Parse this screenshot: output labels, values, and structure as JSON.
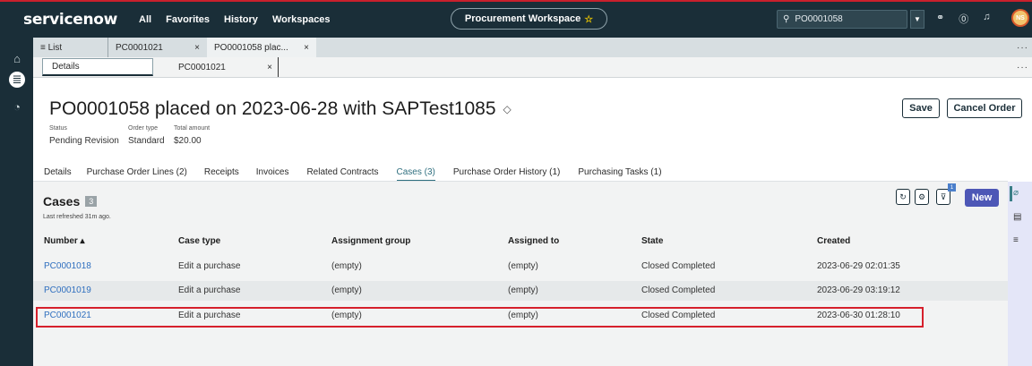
{
  "topbar": {
    "logo": "servicenow",
    "nav": [
      "All",
      "Favorites",
      "History",
      "Workspaces"
    ],
    "workspace": "Procurement Workspace",
    "search_value": "PO0001058",
    "avatar_initials": "NS"
  },
  "tabs_row1": {
    "list_label": "≡ List",
    "tabs": [
      {
        "label": "PC0001021",
        "close": "×"
      },
      {
        "label": "PO0001058 plac...",
        "close": "×"
      }
    ]
  },
  "tabs_row2": {
    "details_label": "Details",
    "tab_label": "PC0001021",
    "close": "×",
    "more": "..."
  },
  "record": {
    "title": "PO0001058 placed on 2023-06-28 with SAPTest1085",
    "save_label": "Save",
    "cancel_label": "Cancel Order",
    "fields": [
      {
        "label": "Status",
        "value": "Pending Revision"
      },
      {
        "label": "Order type",
        "value": "Standard"
      },
      {
        "label": "Total amount",
        "value": "$20.00"
      }
    ]
  },
  "subtabs": [
    "Details",
    "Purchase Order Lines (2)",
    "Receipts",
    "Invoices",
    "Related Contracts",
    "Cases (3)",
    "Purchase Order History (1)",
    "Purchasing Tasks (1)"
  ],
  "cases": {
    "title": "Cases",
    "count": "3",
    "refreshed": "Last refreshed 31m ago.",
    "filter_badge": "1",
    "new_label": "New",
    "columns": [
      "Number ▴",
      "Case type",
      "Assignment group",
      "Assigned to",
      "State",
      "Created"
    ],
    "rows": [
      [
        "PC0001018",
        "Edit a purchase",
        "(empty)",
        "(empty)",
        "Closed Completed",
        "2023-06-29 02:01:35"
      ],
      [
        "PC0001019",
        "Edit a purchase",
        "(empty)",
        "(empty)",
        "Closed Completed",
        "2023-06-29 03:19:12"
      ],
      [
        "PC0001021",
        "Edit a purchase",
        "(empty)",
        "(empty)",
        "Closed Completed",
        "2023-06-30 01:28:10"
      ]
    ]
  }
}
